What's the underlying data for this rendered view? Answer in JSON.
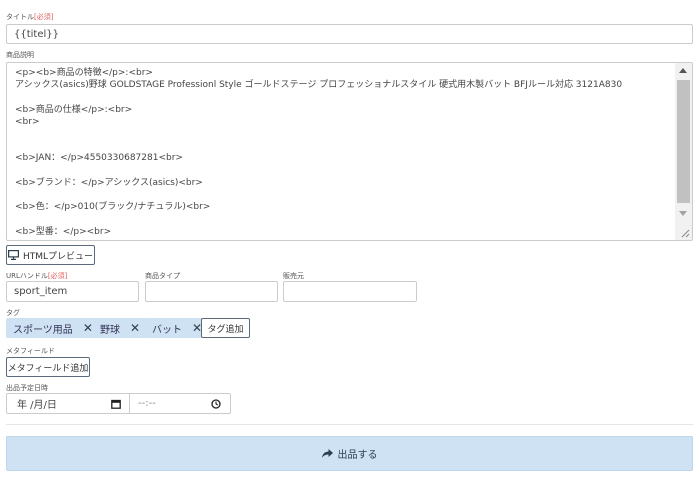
{
  "title_field": {
    "label": "タイトル",
    "required": "[必須]",
    "value": "{{titel}}"
  },
  "description": {
    "label": "商品説明",
    "value": "<p><b>商品の特徴</p>:<br>\nアシックス(asics)野球 GOLDSTAGE Professionl Style ゴールドステージ プロフェッショナルスタイル 硬式用木製バット BFJルール対応 3121A830\n\n<b>商品の仕様</p>:<br>\n<br>\n\n\n<b>JAN：</p>4550330687281<br>\n\n<b>ブランド：</p>アシックス(asics)<br>\n\n<b>色：</p>010(ブラック/ナチュラル)<br>\n\n<b>型番：</p><br>"
  },
  "preview_button": {
    "label": "HTMLプレビュー",
    "icon": "monitor-icon"
  },
  "url_handle": {
    "label": "URLハンドル",
    "required": "[必須]",
    "value": "sport_item"
  },
  "product_type": {
    "label": "商品タイプ",
    "value": ""
  },
  "vendor": {
    "label": "販売元",
    "value": ""
  },
  "tags": {
    "label": "タグ",
    "items": [
      "スポーツ用品",
      "野球",
      "バット"
    ],
    "remove_glyph": "✕",
    "add_label": "タグ追加"
  },
  "metafield": {
    "label": "メタフィールド",
    "add_label": "メタフィールド追加"
  },
  "schedule": {
    "label": "出品予定日時",
    "date_placeholder": "年 /月/日",
    "time_placeholder": "--:--"
  },
  "submit": {
    "label": "出品する",
    "icon": "share-arrow-icon"
  },
  "colors": {
    "tag_bg": "#cfe2f3",
    "submit_bg": "#cfe2f3",
    "required": "#e06060",
    "border": "#cccccc"
  }
}
